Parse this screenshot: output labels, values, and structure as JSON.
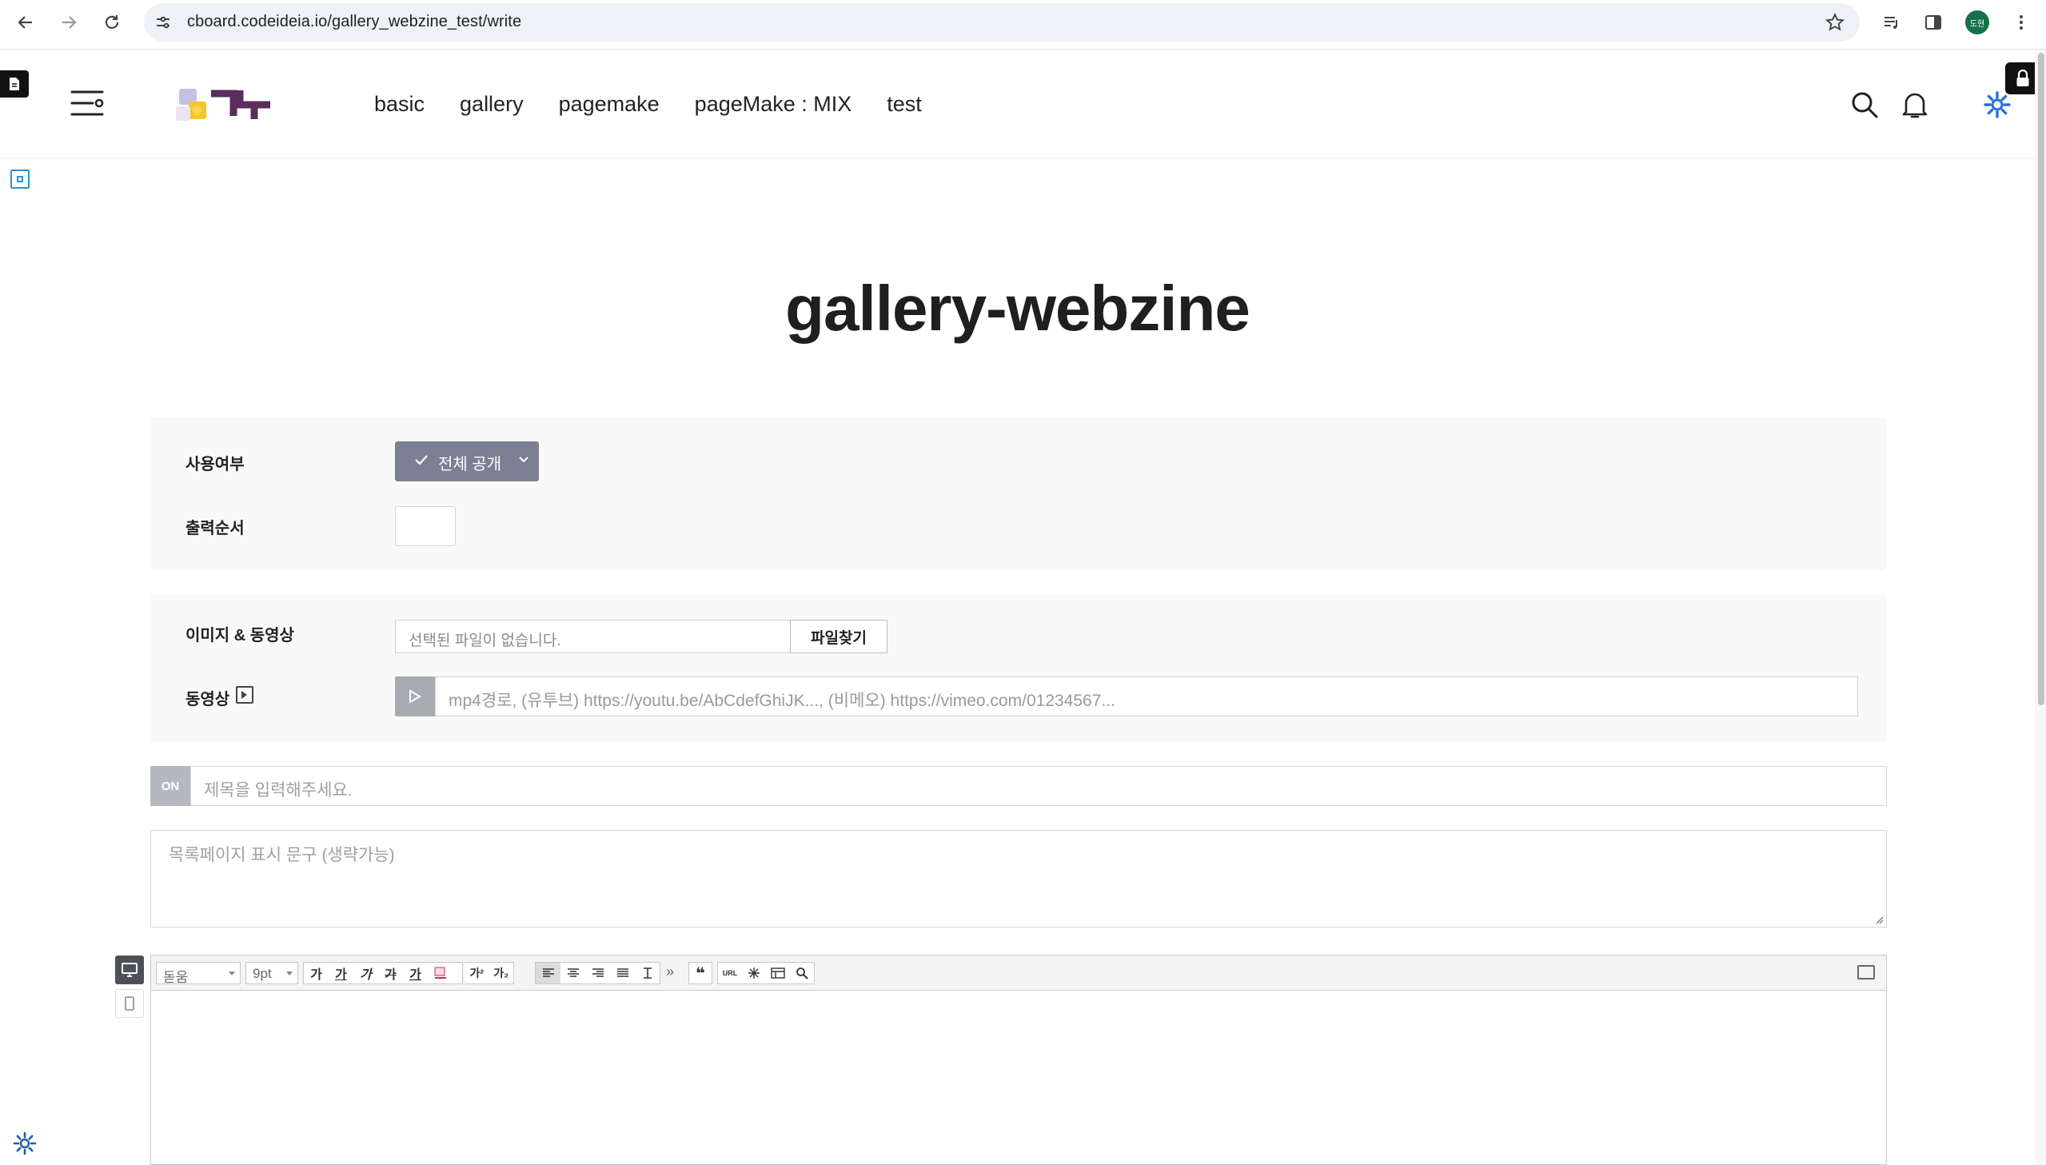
{
  "browser": {
    "url": "cboard.codeideia.io/gallery_webzine_test/write",
    "profile_initials": "도현"
  },
  "header": {
    "nav": [
      {
        "label": "basic"
      },
      {
        "label": "gallery"
      },
      {
        "label": "pagemake"
      },
      {
        "label": "pageMake : MIX"
      },
      {
        "label": "test"
      }
    ]
  },
  "page": {
    "title": "gallery-webzine"
  },
  "settings": {
    "visibility_label": "사용여부",
    "visibility_value": "전체 공개",
    "order_label": "출력순서",
    "order_value": ""
  },
  "media": {
    "file_label": "이미지 & 동영상",
    "file_placeholder": "선택된 파일이 없습니다.",
    "file_button": "파일찾기",
    "video_label": "동영상",
    "video_placeholder": "mp4경로, (유투브) https://youtu.be/AbCdefGhiJK..., (비메오) https://vimeo.com/01234567..."
  },
  "post": {
    "on_toggle": "ON",
    "title_placeholder": "제목을 입력해주세요.",
    "summary_placeholder": "목록페이지 표시 문구 (생략가능)"
  },
  "editor": {
    "font_family": "돋움",
    "font_size": "9pt",
    "format_buttons": [
      "가",
      "가",
      "가",
      "가",
      "가"
    ],
    "sup_label": "가²",
    "sub_label": "가₂",
    "more_label": "»",
    "quote_label": "❝",
    "url_label": "URL"
  },
  "colors": {
    "accent": "#2a93c9",
    "select_bg": "#7b8092",
    "profile_bg": "#17704a"
  }
}
